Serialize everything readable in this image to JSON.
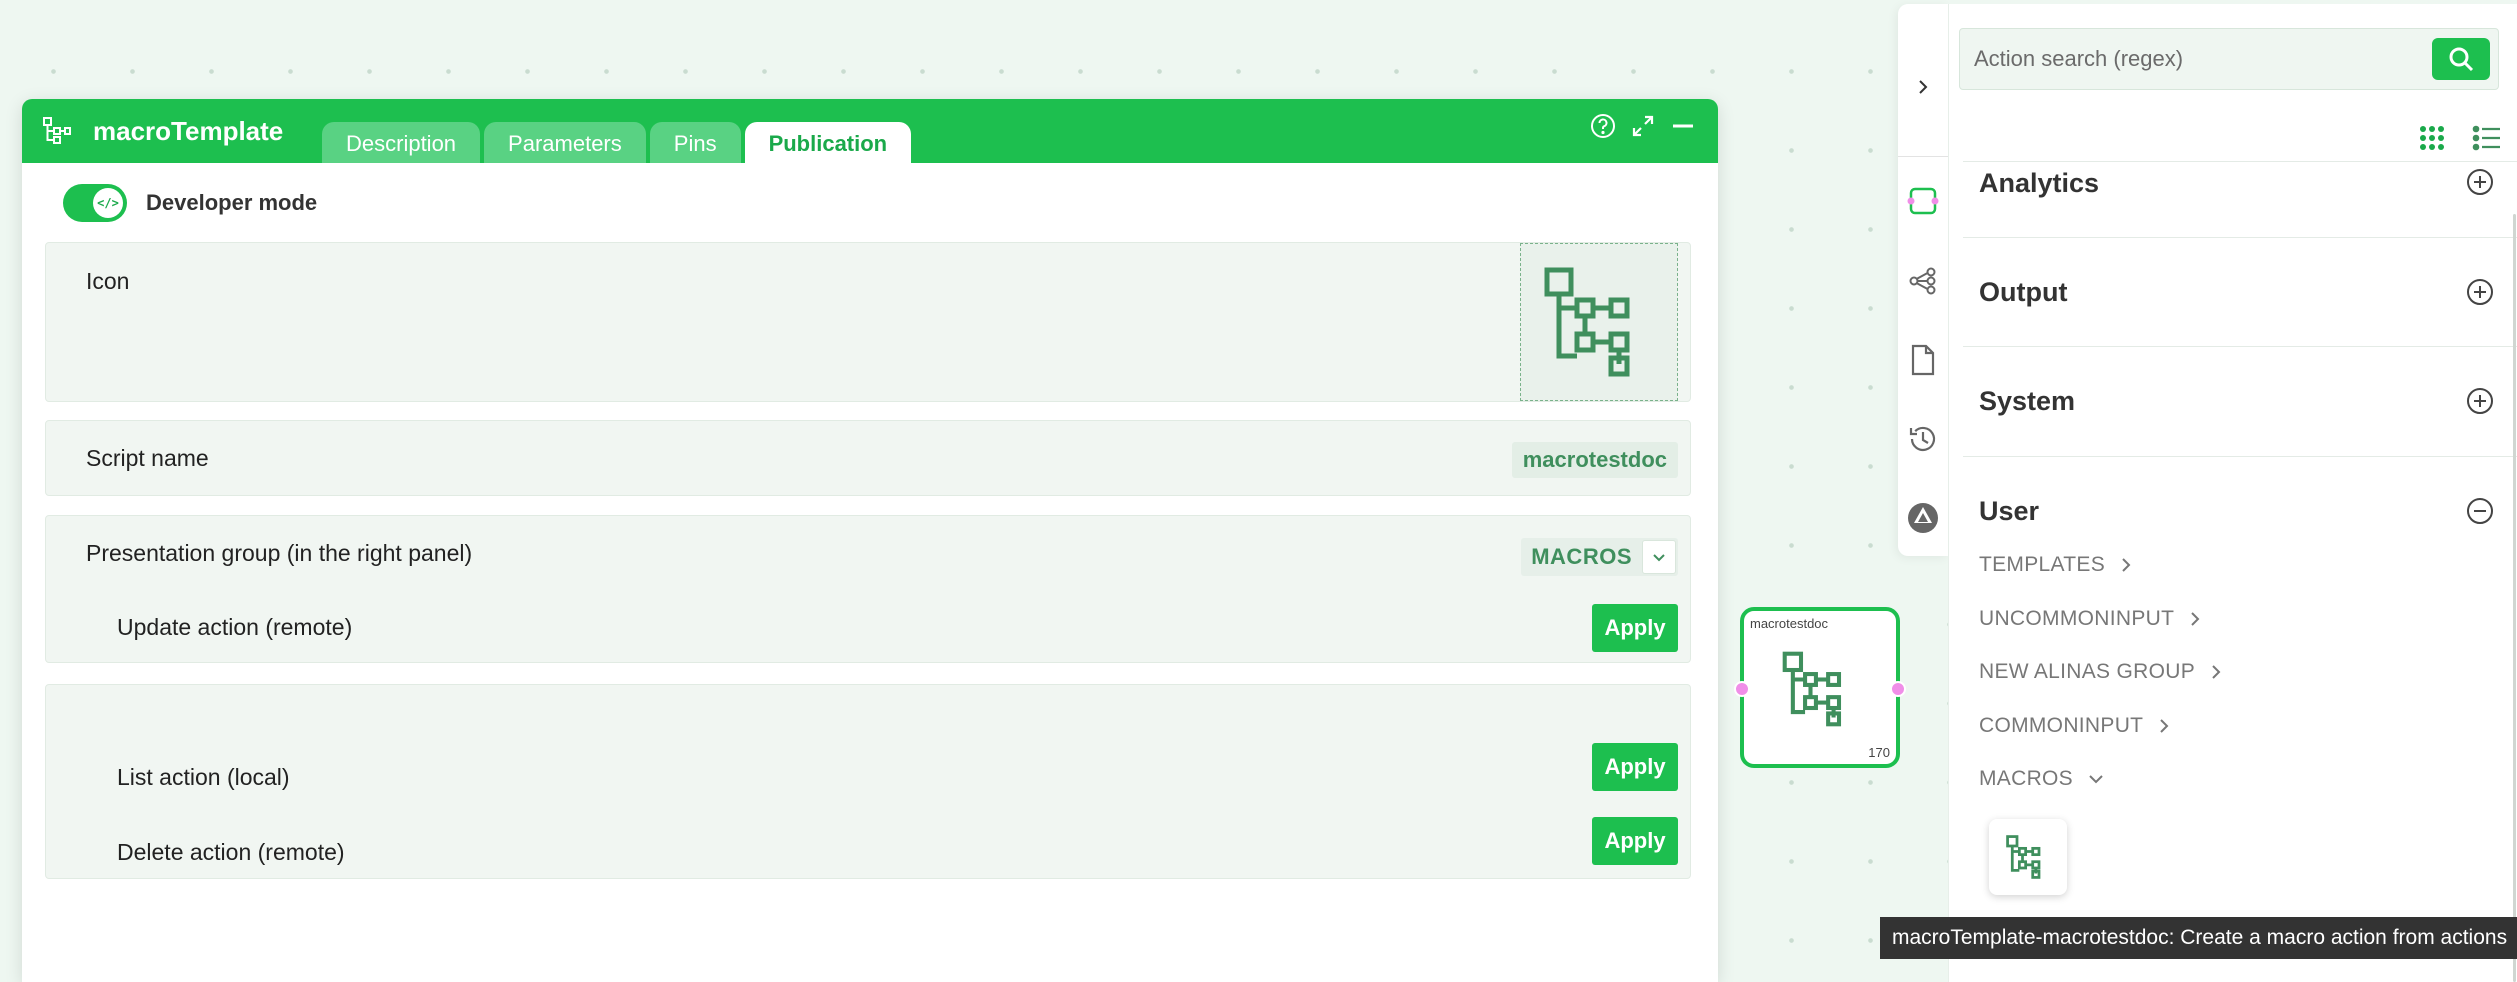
{
  "dialog": {
    "title": "macroTemplate",
    "tabs": [
      {
        "label": "Description",
        "active": false
      },
      {
        "label": "Parameters",
        "active": false
      },
      {
        "label": "Pins",
        "active": false
      },
      {
        "label": "Publication",
        "active": true
      }
    ],
    "developer_mode": {
      "label": "Developer mode",
      "enabled": true,
      "knob_glyph": "</>"
    },
    "icon_label": "Icon",
    "script_name": {
      "label": "Script name",
      "value": "macrotestdoc"
    },
    "presentation_group": {
      "label": "Presentation group (in the right panel)",
      "value": "MACROS"
    },
    "update_action": {
      "label": "Update action (remote)",
      "button": "Apply"
    },
    "list_action": {
      "label": "List action (local)",
      "button": "Apply"
    },
    "delete_action": {
      "label": "Delete action (remote)",
      "button": "Apply"
    }
  },
  "node": {
    "title": "macrotestdoc",
    "count": "170"
  },
  "right_panel": {
    "search_placeholder": "Action search (regex)",
    "categories": [
      {
        "name": "Analytics",
        "expanded": false
      },
      {
        "name": "Output",
        "expanded": false
      },
      {
        "name": "System",
        "expanded": false
      },
      {
        "name": "User",
        "expanded": true
      }
    ],
    "user_groups": [
      "TEMPLATES",
      "UNCOMMONINPUT",
      "NEW ALINAS GROUP",
      "COMMONINPUT",
      "MACROS"
    ]
  },
  "tooltip": "macroTemplate-macrotestdoc: Create a macro action from actions",
  "colors": {
    "accent": "#1dbf4f",
    "icon_green": "#3f8f5d",
    "pin": "#f08ee8",
    "canvas": "#eef7f1"
  },
  "icons": [
    "hierarchy-icon",
    "help-icon",
    "expand-icon",
    "minimize-icon",
    "chevron-down-icon",
    "chevron-right-icon",
    "search-icon",
    "grid-view-icon",
    "list-view-icon",
    "plus-circle-icon",
    "minus-circle-icon",
    "history-icon",
    "document-icon",
    "graph-icon",
    "logo-icon"
  ]
}
